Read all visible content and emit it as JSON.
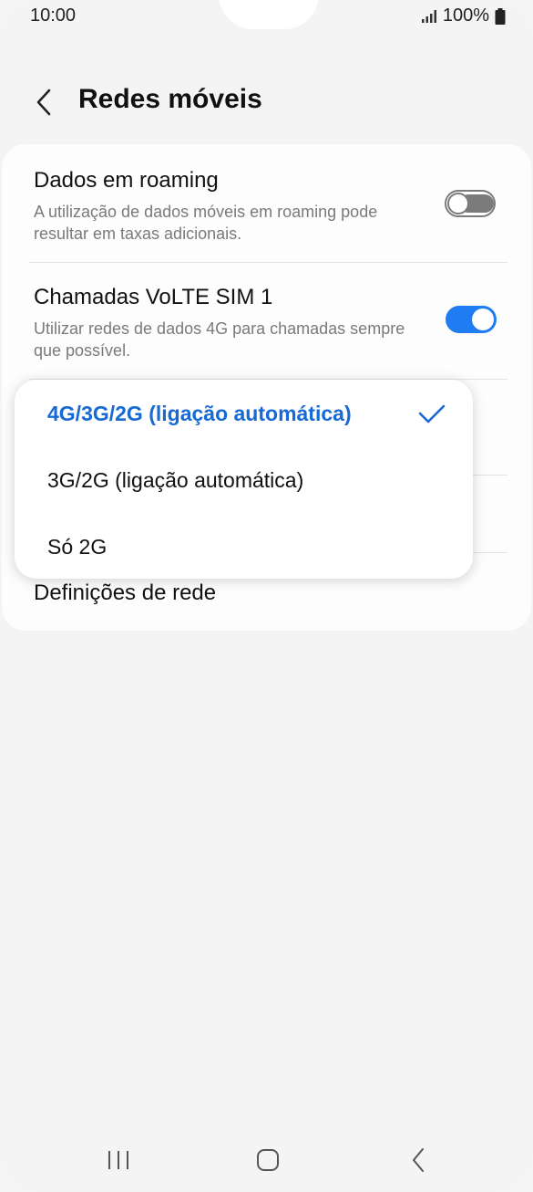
{
  "status_bar": {
    "time": "10:00",
    "battery": "100%",
    "icons": [
      "signal-icon",
      "battery-icon"
    ]
  },
  "header": {
    "title": "Redes móveis",
    "back_icon": "chevron-left-icon"
  },
  "settings": {
    "roaming": {
      "title": "Dados em roaming",
      "description": "A utilização de dados móveis em roaming pode resultar em taxas adicionais.",
      "enabled": false
    },
    "volte": {
      "title": "Chamadas VoLTE SIM 1",
      "description": "Utilizar redes de dados 4G para chamadas sempre que possível.",
      "enabled": true
    },
    "network_settings": {
      "title": "Definições de rede"
    }
  },
  "network_mode_menu": {
    "options": [
      {
        "label": "4G/3G/2G (ligação automática)",
        "selected": true
      },
      {
        "label": "3G/2G (ligação automática)",
        "selected": false
      },
      {
        "label": "Só 2G",
        "selected": false
      }
    ]
  },
  "colors": {
    "accent": "#1f7cf2",
    "selected_text": "#1769d3",
    "background": "#f4f4f4"
  },
  "nav_bar": {
    "icons": [
      "recent-apps-icon",
      "home-icon",
      "back-icon"
    ]
  }
}
